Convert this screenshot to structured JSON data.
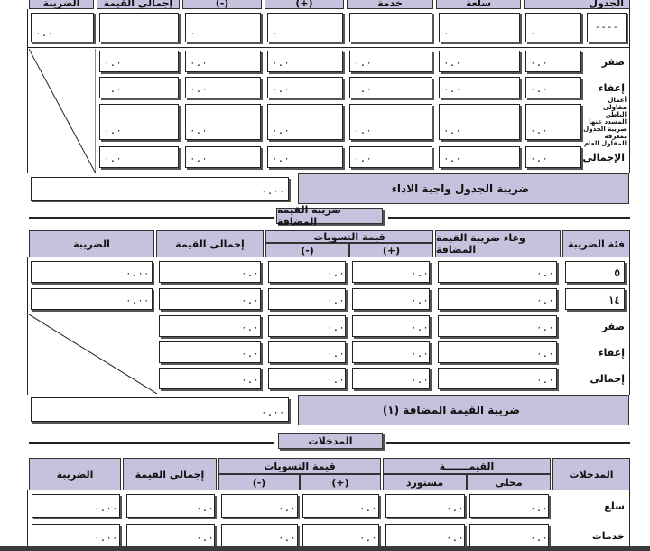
{
  "table_tax": {
    "header_labels": [
      "الجدول",
      "سلعة",
      "خدمة",
      "(+)",
      "(-)",
      "إجمالي القيمة",
      "الضريبة"
    ],
    "row1": {
      "label": "----",
      "values": [
        "٠",
        "٠",
        "٠",
        "٠",
        "٠",
        "٠",
        "٠.٠"
      ]
    },
    "row_zero": {
      "label": "صفر",
      "values": [
        "٠.٠",
        "٠.٠",
        "٠.٠",
        "٠.٠",
        "٠.٠",
        "٠.٠"
      ]
    },
    "row_exempt": {
      "label": "إعفاء",
      "values": [
        "٠.٠",
        "٠.٠",
        "٠.٠",
        "٠.٠",
        "٠.٠",
        "٠.٠"
      ]
    },
    "row_contractors": {
      "label": "أعمال مقاولى الباطن المسدد عنها ضريبة الجدول بمعرفة المقاول العام",
      "values": [
        "٠.٠",
        "٠.٠",
        "٠.٠",
        "٠.٠",
        "٠.٠",
        "٠.٠"
      ]
    },
    "row_total": {
      "label": "الإجمالى",
      "values": [
        "٠.٠",
        "٠.٠",
        "٠.٠",
        "٠.٠",
        "٠.٠",
        "٠.٠"
      ]
    },
    "due_label": "ضريبة الجدول واجبة الاداء",
    "due_value": "٠.٠٠"
  },
  "vat_section": {
    "title": "ضريبة القيمة المضافة",
    "headers": {
      "rate": "فئة الضريبة",
      "base": "وعاء ضريبة القيمة المضافة",
      "adjustments": "قيمة التسويات",
      "plus": "(+)",
      "minus": "(-)",
      "total_value": "إجمالى القيمة",
      "tax": "الضريبة"
    },
    "rows": [
      {
        "label": "٥",
        "values": [
          "٠.٠",
          "٠.٠",
          "٠.٠",
          "٠.٠",
          "٠.٠٠"
        ]
      },
      {
        "label": "١٤",
        "values": [
          "٠.٠",
          "٠.٠",
          "٠.٠",
          "٠.٠",
          "٠.٠٠"
        ]
      },
      {
        "label": "صفر",
        "values": [
          "٠.٠",
          "٠.٠",
          "٠.٠",
          "٠.٠"
        ]
      },
      {
        "label": "إعفاء",
        "values": [
          "٠.٠",
          "٠.٠",
          "٠.٠",
          "٠.٠"
        ]
      },
      {
        "label": "إجمالى",
        "values": [
          "٠.٠",
          "٠.٠",
          "٠.٠",
          "٠.٠"
        ]
      }
    ],
    "total_label": "ضريبة القيمة المضافة (١)",
    "total_value": "٠.٠٠"
  },
  "inputs_section": {
    "title": "المدخلات",
    "headers": {
      "inputs": "المدخلات",
      "value": "القيمـــــــة",
      "local": "محلى",
      "imported": "مستورد",
      "adjustments": "قيمة التسويات",
      "plus": "(+)",
      "minus": "(-)",
      "total_value": "إجمالى القيمة",
      "tax": "الضريبة"
    },
    "rows": [
      {
        "label": "سلع",
        "values": [
          "٠.٠",
          "٠.٠",
          "٠.٠",
          "٠.٠",
          "٠.٠",
          "٠.٠٠"
        ]
      },
      {
        "label": "خدمات",
        "values": [
          "٠.٠",
          "٠.٠",
          "٠.٠",
          "٠.٠",
          "٠.٠",
          "٠.٠٠"
        ]
      }
    ]
  }
}
